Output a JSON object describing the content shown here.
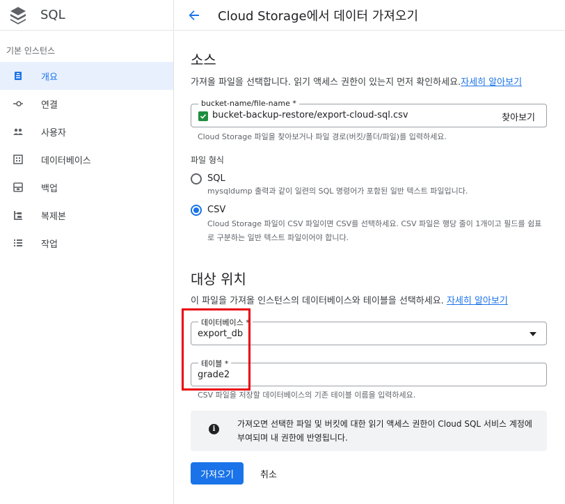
{
  "app": {
    "title": "SQL"
  },
  "sidebar": {
    "section_label": "기본 인스턴스",
    "items": [
      {
        "label": "개요",
        "icon": "overview-icon",
        "active": true
      },
      {
        "label": "연결",
        "icon": "connections-icon"
      },
      {
        "label": "사용자",
        "icon": "users-icon"
      },
      {
        "label": "데이터베이스",
        "icon": "databases-icon"
      },
      {
        "label": "백업",
        "icon": "backups-icon"
      },
      {
        "label": "복제본",
        "icon": "replicas-icon"
      },
      {
        "label": "작업",
        "icon": "operations-icon"
      }
    ]
  },
  "header": {
    "title": "Cloud Storage에서 데이터 가져오기"
  },
  "source": {
    "heading": "소스",
    "description": "가져올 파일을 선택합니다. 읽기 액세스 권한이 있는지 먼저 확인하세요.",
    "learn_more": "자세히 알아보기",
    "file_label": "bucket-name/file-name *",
    "file_value": "bucket-backup-restore/export-cloud-sql.csv",
    "browse_label": "찾아보기",
    "file_helper": "Cloud Storage 파일을 찾아보거나 파일 경로(버킷/폴더/파일)를 입력하세요."
  },
  "format": {
    "label": "파일 형식",
    "options": [
      {
        "label": "SQL",
        "description": "mysqldump 출력과 같이 일련의 SQL 명령어가 포함된 일반 텍스트 파일입니다.",
        "selected": false
      },
      {
        "label": "CSV",
        "description": "Cloud Storage 파일이 CSV 파일이면 CSV를 선택하세요. CSV 파일은 행당 줄이 1개이고 필드를 쉼표로 구분하는 일반 텍스트 파일이어야 합니다.",
        "selected": true
      }
    ]
  },
  "destination": {
    "heading": "대상 위치",
    "description": "이 파일을 가져올 인스턴스의 데이터베이스와 테이블을 선택하세요.",
    "learn_more": "자세히 알아보기",
    "database_label": "데이터베이스 *",
    "database_value": "export_db",
    "table_label": "테이블 *",
    "table_value": "grade2",
    "table_helper": "CSV 파일을 저장할 데이터베이스의 기존 테이블 이름을 입력하세요."
  },
  "info": {
    "text": "가져오면 선택한 파일 및 버킷에 대한 읽기 액세스 권한이 Cloud SQL 서비스 계정에 부여되며 내 권한에 반영됩니다."
  },
  "actions": {
    "import_label": "가져오기",
    "cancel_label": "취소"
  },
  "colors": {
    "accent": "#1a73e8",
    "highlight": "#e8000b",
    "checkbox": "#1e8e3e"
  }
}
